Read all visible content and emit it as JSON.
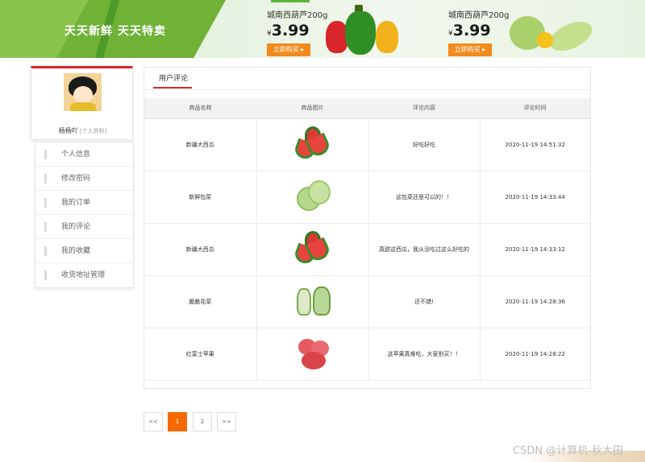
{
  "banner": {
    "promo_left": "天天新鲜",
    "promo_right": "天天特卖",
    "deals": [
      {
        "name": "城南西葫芦200g",
        "currency": "¥",
        "price": "3.99",
        "button": "立即购买 ▸"
      },
      {
        "name": "城南西葫芦200g",
        "currency": "¥",
        "price": "3.99",
        "button": "立即购买 ▸"
      }
    ]
  },
  "user": {
    "name": "杨杨吖",
    "profile_link": "[个人资料]"
  },
  "menu": [
    {
      "label": "个人信息"
    },
    {
      "label": "修改密码"
    },
    {
      "label": "我的订单"
    },
    {
      "label": "我的评论"
    },
    {
      "label": "我的收藏"
    },
    {
      "label": "收货地址管理"
    }
  ],
  "panel": {
    "tab": "用户评论",
    "columns": [
      "商品名称",
      "商品图片",
      "评论内容",
      "评论时间"
    ],
    "rows": [
      {
        "name": "新疆大西瓜",
        "image": "watermelon",
        "comment": "好吃好吃",
        "time": "2020-11-19 14:51:32"
      },
      {
        "name": "新鲜包菜",
        "image": "cabbage",
        "comment": "这包菜还是可以的！！",
        "time": "2020-11-19 14:33:44"
      },
      {
        "name": "新疆大西瓜",
        "image": "watermelon",
        "comment": "真甜这西瓜，我从没吃过这么好吃的",
        "time": "2020-11-19 14:33:12"
      },
      {
        "name": "脆脆花菜",
        "image": "cauliflower",
        "comment": "还不错!",
        "time": "2020-11-19 14:28:36"
      },
      {
        "name": "红富士苹果",
        "image": "apple",
        "comment": "这苹果真难吃，大家别买！！",
        "time": "2020-11-19 14:28:22"
      }
    ]
  },
  "pagination": {
    "prev": "<<",
    "pages": [
      "1",
      "2"
    ],
    "next": ">>",
    "current": "1"
  },
  "watermark": "CSDN @计算机-秋大田"
}
